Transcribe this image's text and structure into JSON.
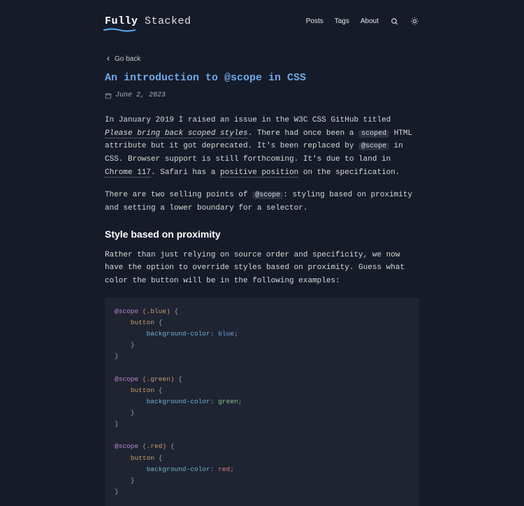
{
  "brand": {
    "first": "Fully",
    "second": "Stacked"
  },
  "nav": {
    "posts": "Posts",
    "tags": "Tags",
    "about": "About",
    "search_icon": "search-icon",
    "theme_icon": "sun-icon"
  },
  "back": "Go back",
  "title": "An introduction to @scope in CSS",
  "date": "June 2, 2023",
  "para1": {
    "t0": "In January 2019 I raised an issue in the W3C CSS GitHub titled ",
    "link1": "Please bring back scoped styles",
    "t1": ". There had once been a ",
    "code1": "scoped",
    "t2": " HTML attribute but it got deprecated. It's been replaced by ",
    "code2": "@scope",
    "t3": " in CSS. Browser support is still forthcoming. It's due to land in ",
    "link2": "Chrome 117",
    "t4": ". Safari has a ",
    "link3": "positive position",
    "t5": " on the specification."
  },
  "para2": {
    "t0": "There are two selling points of ",
    "code1": "@scope",
    "t1": ": styling based on proximity and setting a lower boundary for a selector."
  },
  "section1_heading": "Style based on proximity",
  "para3": "Rather than just relying on source order and specificity, we now have the option to override styles based on proximity. Guess what color the button will be in the following examples:",
  "code": {
    "rule": "@scope",
    "sel_blue": "(.blue)",
    "sel_green": "(.green)",
    "sel_red": "(.red)",
    "open": "{",
    "close": "}",
    "button": "button",
    "prop": "background-color",
    "colon": ":",
    "semi": ";",
    "val_blue": "blue",
    "val_green": "green",
    "val_red": "red"
  }
}
